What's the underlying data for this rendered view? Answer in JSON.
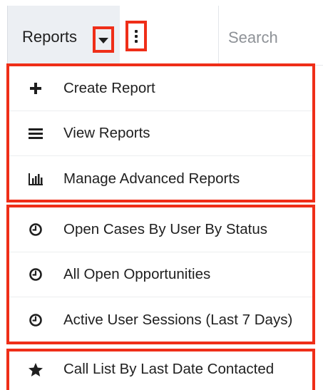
{
  "topbar": {
    "reports_label": "Reports",
    "search_text": "Search"
  },
  "menu": {
    "actions": [
      {
        "label": "Create Report",
        "icon": "plus-icon"
      },
      {
        "label": "View Reports",
        "icon": "list-icon"
      },
      {
        "label": "Manage Advanced Reports",
        "icon": "bar-chart-icon"
      }
    ],
    "recent": [
      {
        "label": "Open Cases By User By Status",
        "icon": "clock-icon"
      },
      {
        "label": "All Open Opportunities",
        "icon": "clock-icon"
      },
      {
        "label": "Active User Sessions (Last 7 Days)",
        "icon": "clock-icon"
      }
    ],
    "favorites": [
      {
        "label": "Call List By Last Date Contacted",
        "icon": "star-icon"
      }
    ]
  },
  "colors": {
    "highlight": "#ef2e18",
    "tab_background": "#eceff3",
    "text": "#1f1f1f",
    "muted_text": "#8e9297"
  }
}
